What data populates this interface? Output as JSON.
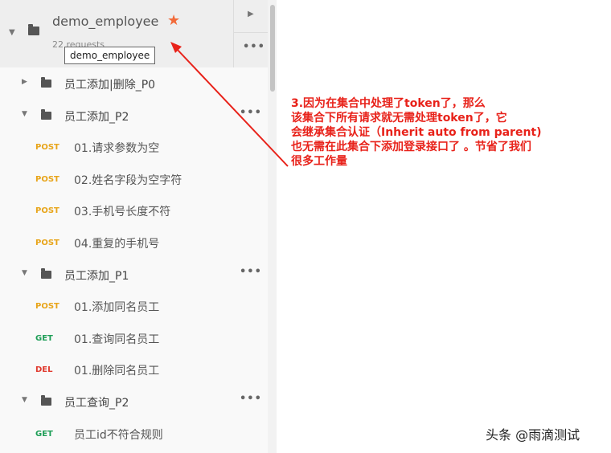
{
  "collection": {
    "name": "demo_employee",
    "requests_text": "22 requests",
    "tooltip": "demo_employee"
  },
  "items": [
    {
      "kind": "folder",
      "label": "员工添加|删除_P0",
      "expanded": false,
      "more": false
    },
    {
      "kind": "folder",
      "label": "员工添加_P2",
      "expanded": true,
      "more": true
    },
    {
      "kind": "request",
      "method": "POST",
      "label": "01.请求参数为空"
    },
    {
      "kind": "request",
      "method": "POST",
      "label": "02.姓名字段为空字符"
    },
    {
      "kind": "request",
      "method": "POST",
      "label": "03.手机号长度不符"
    },
    {
      "kind": "request",
      "method": "POST",
      "label": "04.重复的手机号"
    },
    {
      "kind": "folder",
      "label": "员工添加_P1",
      "expanded": true,
      "more": true
    },
    {
      "kind": "request",
      "method": "POST",
      "label": "01.添加同名员工"
    },
    {
      "kind": "request",
      "method": "GET",
      "label": "01.查询同名员工"
    },
    {
      "kind": "request",
      "method": "DEL",
      "label": "01.删除同名员工"
    },
    {
      "kind": "folder",
      "label": "员工查询_P2",
      "expanded": true,
      "more": true
    },
    {
      "kind": "request",
      "method": "GET",
      "label": "员工id不符合规则"
    }
  ],
  "annotation": {
    "lines": [
      "3.因为在集合中处理了token了，那么",
      "该集合下所有请求就无需处理token了，它",
      "会继承集合认证（Inherit auto from parent)",
      "也无需在此集合下添加登录接口了 。节省了我们",
      "很多工作量"
    ],
    "color": "#e8221a"
  },
  "watermark": "头条 @雨滴测试",
  "colors": {
    "post": "#e8a51b",
    "get": "#1e9e57",
    "del": "#e03a2e",
    "star": "#f26b3a"
  }
}
